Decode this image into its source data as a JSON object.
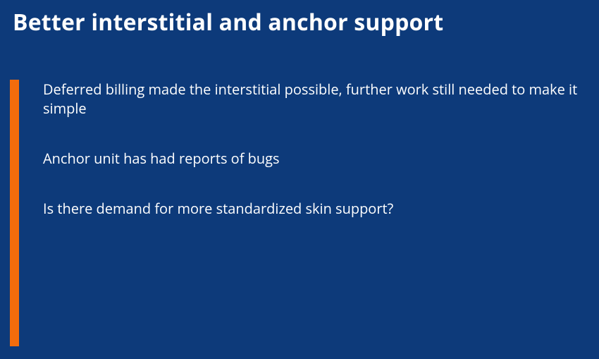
{
  "slide": {
    "title": "Better interstitial and anchor support",
    "accent_color": "#f26c0c",
    "background_color": "#0d3a7a",
    "bullets": [
      "Deferred billing made the interstitial possible, further work still needed to make it simple",
      "Anchor unit has had reports of bugs",
      "Is there demand for more standardized skin support?"
    ]
  }
}
